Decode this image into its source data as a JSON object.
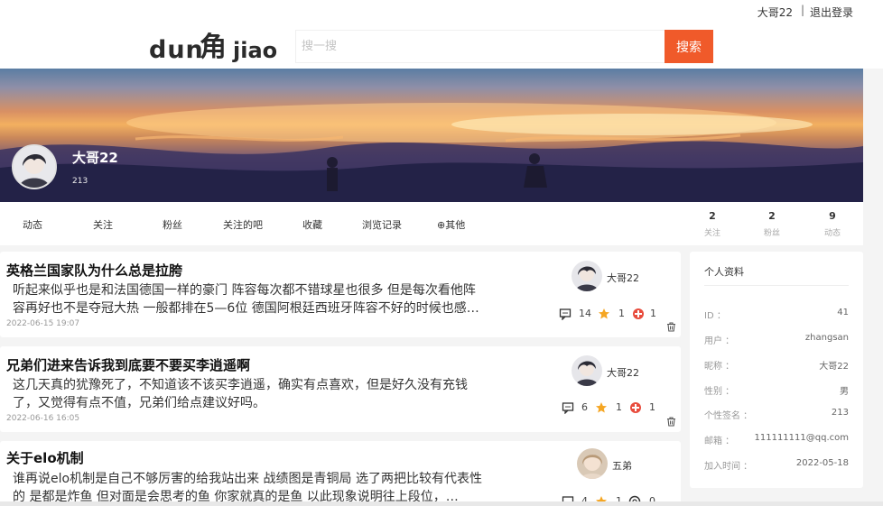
{
  "topbar": {
    "username": "大哥22",
    "separator": "|",
    "logout": "退出登录"
  },
  "header": {
    "logo_text": "dun角jiao",
    "search_placeholder": "搜一搜",
    "search_button": "搜索"
  },
  "profile": {
    "name": "大哥22",
    "subtitle": "213"
  },
  "nav": {
    "tabs": [
      "动态",
      "关注",
      "粉丝",
      "关注的吧",
      "收藏",
      "浏览记录",
      "⊕其他"
    ],
    "stats": [
      {
        "num": "2",
        "label": "关注"
      },
      {
        "num": "2",
        "label": "粉丝"
      },
      {
        "num": "9",
        "label": "动态"
      }
    ]
  },
  "posts": [
    {
      "title": "英格兰国家队为什么总是拉胯",
      "excerpt": "听起来似乎也是和法国德国一样的豪门 阵容每次都不错球星也很多 但是每次看他阵容再好也不是夺冠大热 一般都排在5—6位 德国阿根廷西班牙阵容不好的时候也感…",
      "date": "2022-06-15 19:07",
      "author": "大哥22",
      "comments": "14",
      "stars": "1",
      "likes": "1"
    },
    {
      "title": "兄弟们进来告诉我到底要不要买李逍遥啊",
      "excerpt": "这几天真的犹豫死了，不知道该不该买李逍遥，确实有点喜欢，但是好久没有充钱了，又觉得有点不值，兄弟们给点建议好吗。",
      "date": "2022-06-16 16:05",
      "author": "大哥22",
      "comments": "6",
      "stars": "1",
      "likes": "1"
    },
    {
      "title": "关于elo机制",
      "excerpt": "谁再说elo机制是自己不够厉害的给我站出来 战绩图是青铜局 选了两把比较有代表性的 是都是炸鱼 但对面是会思考的鱼 你家就真的是鱼 以此现象说明往上段位，…",
      "date": "",
      "author": "五弟",
      "comments": "4",
      "stars": "1",
      "likes": "0"
    }
  ],
  "sidebar": {
    "title": "个人资料",
    "rows": [
      {
        "key": "ID ：",
        "value": "41"
      },
      {
        "key": "用户 ：",
        "value": "zhangsan"
      },
      {
        "key": "昵称 ：",
        "value": "大哥22"
      },
      {
        "key": "性别 ：",
        "value": "男"
      },
      {
        "key": "个性签名 ：",
        "value": "213"
      },
      {
        "key": "邮箱 ：",
        "value": "111111111@qq.com"
      },
      {
        "key": "加入时间 ：",
        "value": "2022-05-18"
      }
    ]
  },
  "colors": {
    "accent": "#f05a2a",
    "star": "#f5a623",
    "like": "#e84c3d"
  }
}
